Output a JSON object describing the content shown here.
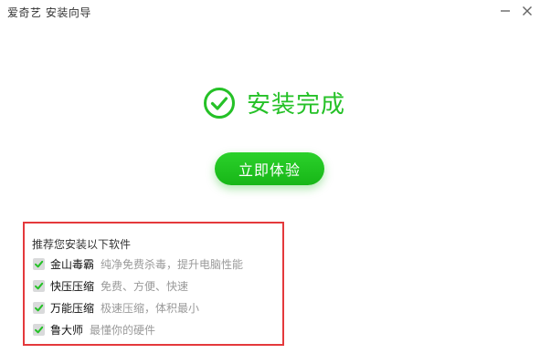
{
  "window": {
    "title": "爱奇艺 安装向导"
  },
  "status": {
    "text": "安装完成"
  },
  "actions": {
    "start_label": "立即体验"
  },
  "recommend": {
    "title": "推荐您安装以下软件",
    "items": [
      {
        "name": "金山毒霸",
        "desc": "纯净免费杀毒，提升电脑性能",
        "checked": true
      },
      {
        "name": "快压压缩",
        "desc": "免费、方便、快速",
        "checked": true
      },
      {
        "name": "万能压缩",
        "desc": "极速压缩，体积最小",
        "checked": true
      },
      {
        "name": "鲁大师",
        "desc": "最懂你的硬件",
        "checked": true
      }
    ]
  },
  "colors": {
    "accent": "#25c127",
    "button": "#17b617",
    "highlight_border": "#e4393c",
    "checkbox_bg": "#d9dadb",
    "check_mark": "#25c127"
  },
  "icons": {
    "status": "check-circle-icon",
    "minimize": "minimize-icon",
    "close": "close-icon",
    "checkbox": "checkmark-icon"
  }
}
